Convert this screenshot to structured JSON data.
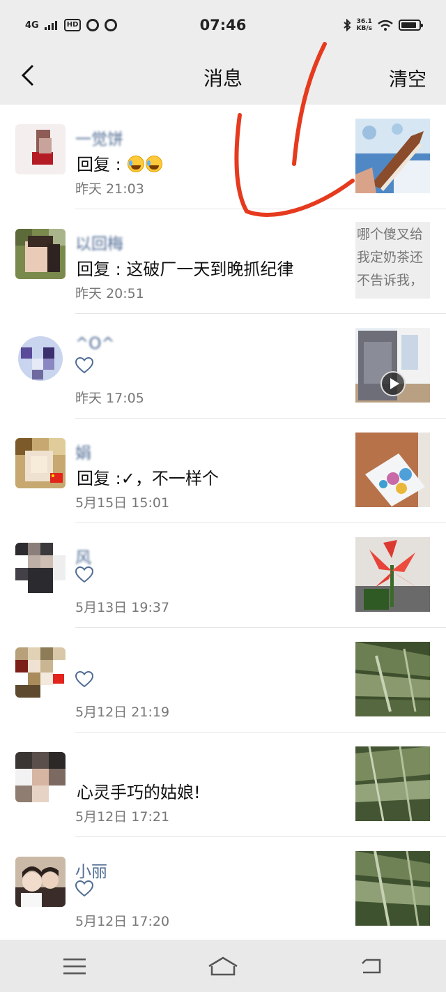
{
  "status_bar": {
    "network": "4G",
    "hd": "HD",
    "time": "07:46",
    "speed_value": "36.1",
    "speed_unit": "KB/s"
  },
  "header": {
    "back_icon": "chevron-left-icon",
    "title": "消息",
    "clear_label": "清空"
  },
  "messages": [
    {
      "name": "一觉饼",
      "content": "回复  : ",
      "time": "昨天 21:03",
      "kind": "reply-emoji",
      "thumb": "photo"
    },
    {
      "name": "以回梅",
      "content": "回复   : 这破厂一天到晚抓纪律",
      "time": "昨天 20:51",
      "kind": "reply",
      "thumb_text": "哪个傻叉给我定奶茶还不告诉我，"
    },
    {
      "name": "   ^O^",
      "content": "",
      "time": "昨天 17:05",
      "kind": "like",
      "thumb": "video"
    },
    {
      "name": "  娟",
      "content": "回复   :✓，不一样个",
      "time": "5月15日 15:01",
      "kind": "reply",
      "thumb": "photo"
    },
    {
      "name": "风",
      "content": "",
      "time": "5月13日 19:37",
      "kind": "like",
      "thumb": "photo"
    },
    {
      "name": "",
      "content": "",
      "time": "5月12日 21:19",
      "kind": "like",
      "thumb": "photo"
    },
    {
      "name": "",
      "content": "心灵手巧的姑娘!",
      "time": "5月12日 17:21",
      "kind": "comment",
      "thumb": "photo"
    },
    {
      "name": "小丽",
      "content": "",
      "time": "5月12日 17:20",
      "kind": "like",
      "thumb": "photo"
    }
  ],
  "nav": {
    "menu_icon": "menu-icon",
    "home_icon": "home-icon",
    "back_icon": "back-icon"
  },
  "colors": {
    "name_link": "#506c94",
    "annotation_red": "#e63a1e",
    "header_bg": "#ededed"
  }
}
